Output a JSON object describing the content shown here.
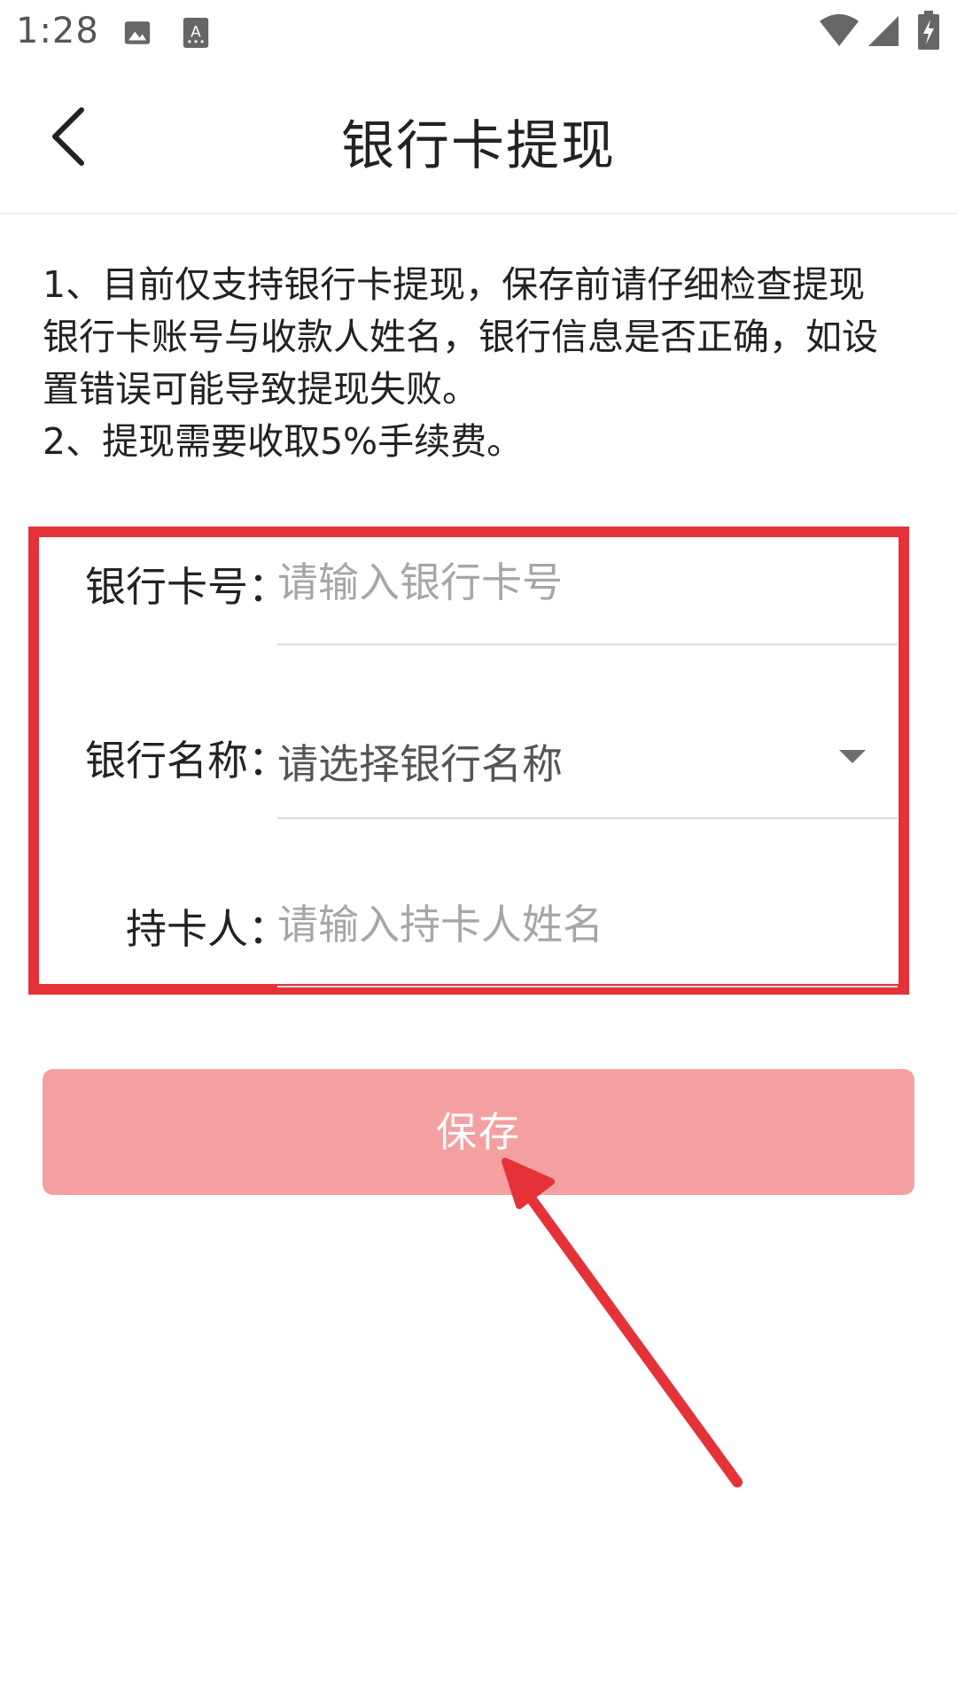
{
  "status_bar": {
    "time": "1:28",
    "icons": [
      "image-icon",
      "keyboard-a-icon",
      "wifi-icon",
      "signal-icon",
      "battery-charging-icon"
    ]
  },
  "header": {
    "title": "银行卡提现",
    "back_icon": "chevron-left-icon"
  },
  "notice": {
    "lines": [
      "1、目前仅支持银行卡提现，保存前请仔细检查提现",
      "银行卡账号与收款人姓名，银行信息是否正确，如设",
      "置错误可能导致提现失败。",
      "2、提现需要收取5%手续费。"
    ]
  },
  "form": {
    "card_number": {
      "label": "银行卡号：",
      "placeholder": "请输入银行卡号",
      "value": ""
    },
    "bank_name": {
      "label": "银行名称：",
      "selected": "请选择银行名称",
      "icon": "dropdown-arrow-icon"
    },
    "holder": {
      "label": "持卡人：",
      "placeholder": "请输入持卡人姓名",
      "value": ""
    }
  },
  "actions": {
    "save_label": "保存"
  },
  "colors": {
    "highlight": "#e53238",
    "save_button": "#f5a0a0",
    "annotation_arrow": "#e53238"
  }
}
